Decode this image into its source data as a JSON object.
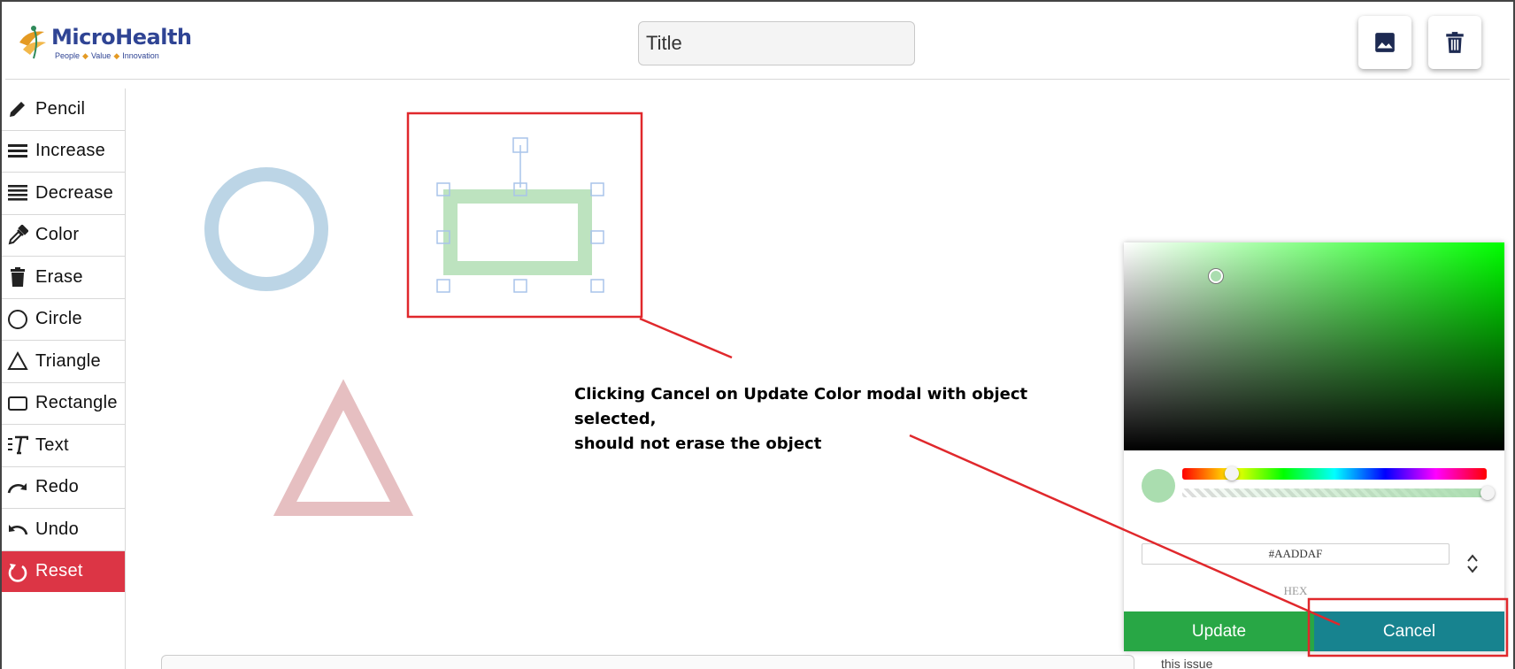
{
  "header": {
    "logo_name": "MicroHealth",
    "logo_tag_1": "People",
    "logo_tag_2": "Value",
    "logo_tag_3": "Innovation",
    "title_placeholder": "Title",
    "image_button_icon": "image-icon",
    "delete_button_icon": "trash-icon"
  },
  "sidebar": {
    "items": [
      {
        "label": "Pencil",
        "icon": "pencil-icon"
      },
      {
        "label": "Increase",
        "icon": "lines-increase-icon"
      },
      {
        "label": "Decrease",
        "icon": "lines-decrease-icon"
      },
      {
        "label": "Color",
        "icon": "eyedropper-icon"
      },
      {
        "label": "Erase",
        "icon": "trash-icon"
      },
      {
        "label": "Circle",
        "icon": "circle-icon"
      },
      {
        "label": "Triangle",
        "icon": "triangle-icon"
      },
      {
        "label": "Rectangle",
        "icon": "rectangle-icon"
      },
      {
        "label": "Text",
        "icon": "text-icon"
      },
      {
        "label": "Redo",
        "icon": "redo-icon"
      },
      {
        "label": "Undo",
        "icon": "undo-icon"
      },
      {
        "label": "Reset",
        "icon": "reset-icon"
      }
    ]
  },
  "canvas": {
    "circle_color": "#bcd5e6",
    "rectangle_color": "#bde3bf",
    "triangle_color": "#e6bfc1",
    "selection_color": "#a9c4ea"
  },
  "annotation": {
    "line_1": "Clicking Cancel on Update Color modal with object selected,",
    "line_2": "should not erase the object",
    "color": "#e0282c"
  },
  "color_picker": {
    "hex_value": "#AADDAF",
    "hex_label": "HEX",
    "update_label": "Update",
    "cancel_label": "Cancel",
    "update_color": "#28a745",
    "cancel_color": "#17838f"
  },
  "background": {
    "partial_text": "this issue"
  },
  "colors": {
    "reset_red": "#dc3545",
    "logo_blue": "#2f4494",
    "logo_orange": "#e49a23"
  }
}
